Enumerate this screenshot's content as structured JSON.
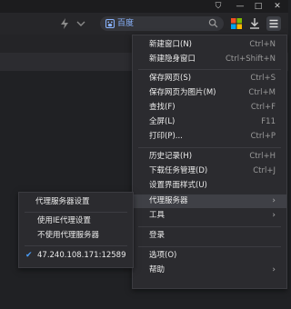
{
  "window": {
    "controls": [
      "⛉",
      "—",
      "□",
      "✕"
    ]
  },
  "toolbar": {
    "search_engine_label": "百度"
  },
  "main_menu": {
    "items": [
      {
        "label": "新建窗口(N)",
        "shortcut": "Ctrl+N"
      },
      {
        "label": "新建隐身窗口",
        "shortcut": "Ctrl+Shift+N"
      },
      {
        "label": "保存网页(S)",
        "shortcut": "Ctrl+S"
      },
      {
        "label": "保存网页为图片(M)",
        "shortcut": "Ctrl+M"
      },
      {
        "label": "查找(F)",
        "shortcut": "Ctrl+F"
      },
      {
        "label": "全屏(L)",
        "shortcut": "F11"
      },
      {
        "label": "打印(P)...",
        "shortcut": "Ctrl+P"
      },
      {
        "label": "历史记录(H)",
        "shortcut": "Ctrl+H"
      },
      {
        "label": "下载任务管理(D)",
        "shortcut": "Ctrl+J"
      },
      {
        "label": "设置界面样式(U)",
        "shortcut": ""
      },
      {
        "label": "代理服务器",
        "shortcut": "›"
      },
      {
        "label": "工具",
        "shortcut": "›"
      },
      {
        "label": "登录",
        "shortcut": ""
      },
      {
        "label": "选项(O)",
        "shortcut": ""
      },
      {
        "label": "帮助",
        "shortcut": "›"
      }
    ]
  },
  "proxy_submenu": {
    "items": [
      {
        "label": "代理服务器设置"
      },
      {
        "label": "使用IE代理设置"
      },
      {
        "label": "不使用代理服务器"
      },
      {
        "label": "47.240.108.171:12589",
        "check": "✔"
      }
    ]
  },
  "colors": {
    "accent": "#4a9df8",
    "menu_bg": "#2b2b2f",
    "highlight": "#3f4046"
  }
}
